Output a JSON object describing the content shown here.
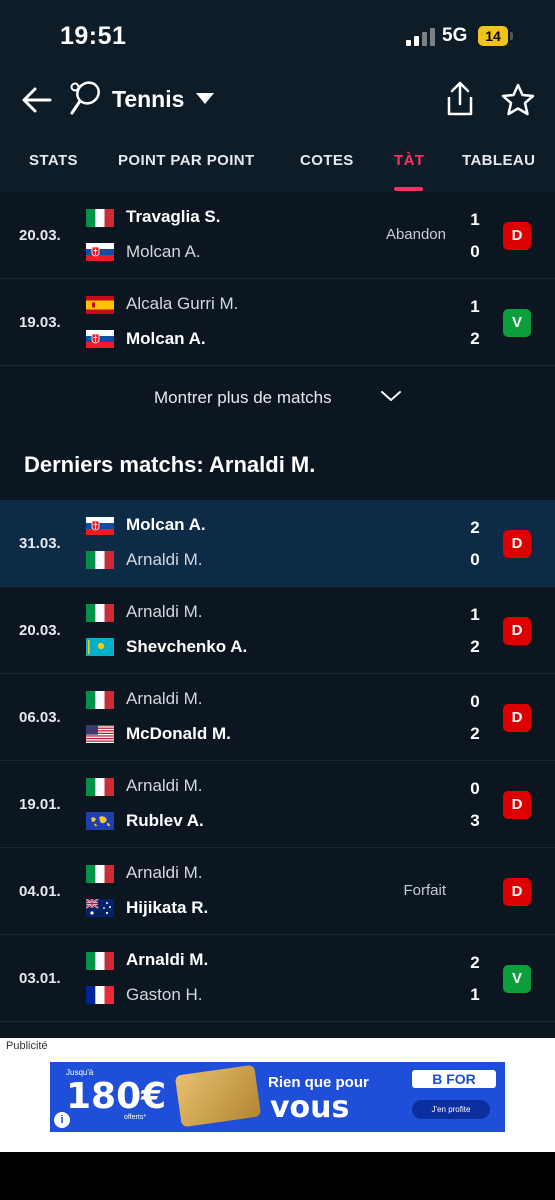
{
  "status_bar": {
    "time": "19:51",
    "network": "5G",
    "battery": "14"
  },
  "header": {
    "title": "Tennis"
  },
  "tabs": [
    {
      "label": "STATS"
    },
    {
      "label": "POINT PAR POINT"
    },
    {
      "label": "COTES"
    },
    {
      "label": "TÀT"
    },
    {
      "label": "TABLEAU"
    }
  ],
  "colors": {
    "accent": "#ff2f63",
    "loss": "#dc0000",
    "win": "#0d9e3c",
    "highlight": "#0d2a47"
  },
  "top_matches": [
    {
      "date": "20.03.",
      "p1": {
        "name": "Travaglia S.",
        "flag": "italy",
        "score": "1",
        "bold": true
      },
      "p2": {
        "name": "Molcan A.",
        "flag": "slovakia",
        "score": "0",
        "bold": false
      },
      "note": "Abandon",
      "result": "D"
    },
    {
      "date": "19.03.",
      "p1": {
        "name": "Alcala Gurri M.",
        "flag": "spain",
        "score": "1",
        "bold": false
      },
      "p2": {
        "name": "Molcan A.",
        "flag": "slovakia",
        "score": "2",
        "bold": true
      },
      "note": "",
      "result": "V"
    }
  ],
  "show_more": {
    "label": "Montrer plus de matchs"
  },
  "section": {
    "title": "Derniers matchs: Arnaldi M."
  },
  "last_matches": [
    {
      "date": "31.03.",
      "highlight": true,
      "p1": {
        "name": "Molcan A.",
        "flag": "slovakia",
        "score": "2",
        "bold": true
      },
      "p2": {
        "name": "Arnaldi M.",
        "flag": "italy",
        "score": "0",
        "bold": false
      },
      "note": "",
      "result": "D"
    },
    {
      "date": "20.03.",
      "p1": {
        "name": "Arnaldi M.",
        "flag": "italy",
        "score": "1",
        "bold": false
      },
      "p2": {
        "name": "Shevchenko A.",
        "flag": "kazakhstan",
        "score": "2",
        "bold": true
      },
      "note": "",
      "result": "D"
    },
    {
      "date": "06.03.",
      "p1": {
        "name": "Arnaldi M.",
        "flag": "italy",
        "score": "0",
        "bold": false
      },
      "p2": {
        "name": "McDonald M.",
        "flag": "usa",
        "score": "2",
        "bold": true
      },
      "note": "",
      "result": "D"
    },
    {
      "date": "19.01.",
      "p1": {
        "name": "Arnaldi M.",
        "flag": "italy",
        "score": "0",
        "bold": false
      },
      "p2": {
        "name": "Rublev A.",
        "flag": "world",
        "score": "3",
        "bold": true
      },
      "note": "",
      "result": "D"
    },
    {
      "date": "04.01.",
      "p1": {
        "name": "Arnaldi M.",
        "flag": "italy",
        "score": "",
        "bold": false
      },
      "p2": {
        "name": "Hijikata R.",
        "flag": "australia",
        "score": "",
        "bold": true
      },
      "note": "Forfait",
      "result": "D"
    },
    {
      "date": "03.01.",
      "p1": {
        "name": "Arnaldi M.",
        "flag": "italy",
        "score": "2",
        "bold": true
      },
      "p2": {
        "name": "Gaston H.",
        "flag": "france",
        "score": "1",
        "bold": false
      },
      "note": "",
      "result": "V"
    }
  ],
  "ad": {
    "label": "Publicité",
    "small": "Jusqu'à",
    "amount": "180€",
    "offered": "offerts*",
    "tagline1": "Rien que pour",
    "tagline2": "vous",
    "brand": "B FOR",
    "cta": "J'en profite",
    "info": "i"
  }
}
